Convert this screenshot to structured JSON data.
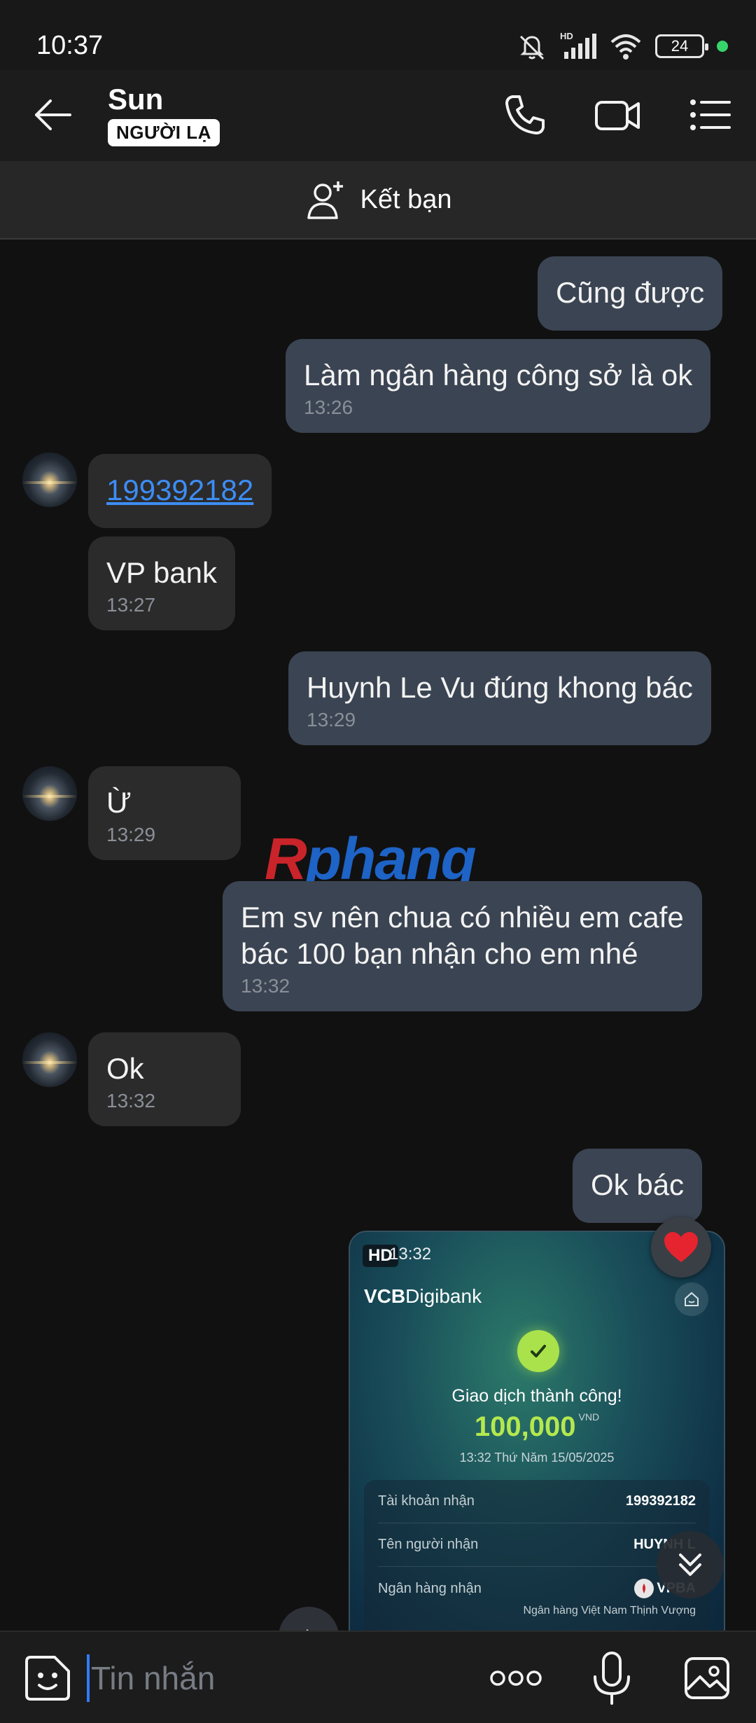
{
  "status_bar": {
    "time": "10:37",
    "battery": "24",
    "network": "HD"
  },
  "header": {
    "contact_name": "Sun",
    "badge": "NGƯỜI LẠ"
  },
  "friend_bar": {
    "label": "Kết bạn"
  },
  "messages": [
    {
      "dir": "out",
      "text": "Cũng được"
    },
    {
      "dir": "out",
      "text": "Làm ngân hàng công sở là ok",
      "time": "13:26"
    },
    {
      "dir": "in",
      "text": "199392182",
      "link": true
    },
    {
      "dir": "in",
      "text": "VP bank",
      "time": "13:27"
    },
    {
      "dir": "out",
      "text": "Huynh Le Vu đúng khong bác",
      "time": "13:29"
    },
    {
      "dir": "in",
      "text": "Ừ",
      "time": "13:29"
    },
    {
      "dir": "out",
      "text_lines": [
        "Em sv nên chua có nhiều em cafe",
        "bác 100 bạn nhận cho em nhé"
      ],
      "time": "13:32"
    },
    {
      "dir": "in",
      "text": "Ok",
      "time": "13:32"
    },
    {
      "dir": "out",
      "text": "Ok bác"
    }
  ],
  "watermark": {
    "first": "R",
    "rest": "phang"
  },
  "receipt": {
    "hd": "HD",
    "time": "13:32",
    "brand_bold": "VCB",
    "brand_rest": "Digibank",
    "success": "Giao dịch thành công!",
    "amount": "100,000",
    "currency": "VND",
    "date": "13:32 Thứ Năm 15/05/2025",
    "rows": [
      {
        "label": "Tài khoản nhận",
        "value": "199392182"
      },
      {
        "label": "Tên người nhận",
        "value": "HUYNH L"
      },
      {
        "label": "Ngân hàng nhận",
        "value": "VPBA"
      }
    ],
    "bank_full": "Ngân hàng Việt Nam Thịnh Vượng"
  },
  "input": {
    "placeholder": "Tin nhắn"
  },
  "colors": {
    "outgoing_bubble": "#3b4452",
    "incoming_bubble": "#2b2b2b",
    "link": "#3d8df5",
    "accent": "#2f7cf6",
    "amount": "#b4e84e"
  }
}
